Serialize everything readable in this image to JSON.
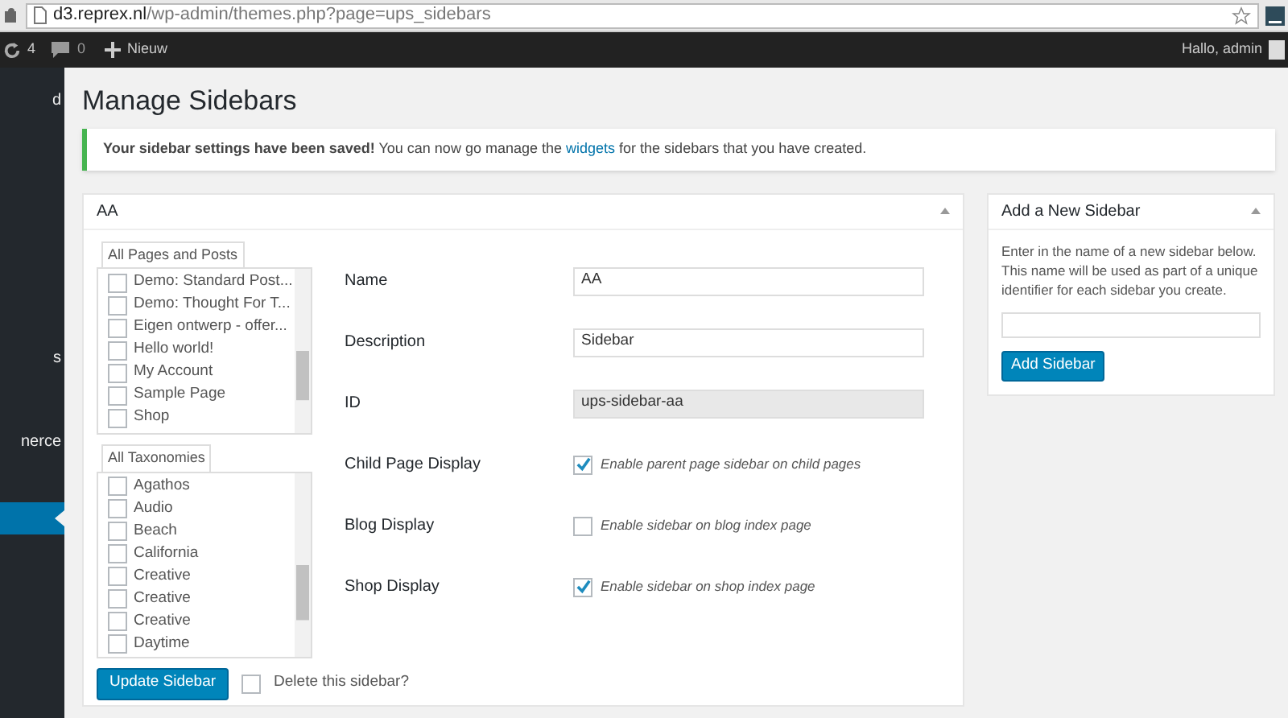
{
  "browser": {
    "url_host": "d3.reprex.nl",
    "url_path": "/wp-admin/themes.php?page=ups_sidebars"
  },
  "admin_bar": {
    "updates": "4",
    "comments": "0",
    "new_label": "Nieuw",
    "greeting": "Hallo, admin"
  },
  "admin_menu": [
    {
      "label": "d",
      "selected": false
    },
    {
      "label": "s",
      "selected": false
    },
    {
      "label": "nerce",
      "selected": false
    },
    {
      "selected": true
    }
  ],
  "page_title": "Manage Sidebars",
  "notice": {
    "text": "**Your sidebar settings have been saved!** You can now go manage the",
    "link": "widgets",
    "text_after": "for the sidebars that you have created."
  },
  "sidebar_box": {
    "title": "AA",
    "pages_list": {
      "tab": "All Pages and Posts",
      "items": [
        {
          "label": "Demo: Standard Post...",
          "checked": false
        },
        {
          "label": "Demo: Thought For T...",
          "checked": false
        },
        {
          "label": "Eigen ontwerp - offer...",
          "checked": false
        },
        {
          "label": "Hello world!",
          "checked": false
        },
        {
          "label": "My Account",
          "checked": false
        },
        {
          "label": "Sample Page",
          "checked": false
        },
        {
          "label": "Shop",
          "checked": false
        }
      ]
    },
    "taxonomies_list": {
      "tab": "All Taxonomies",
      "items": [
        {
          "label": "Agathos",
          "checked": false
        },
        {
          "label": "Audio",
          "checked": false
        },
        {
          "label": "Beach",
          "checked": false
        },
        {
          "label": "California",
          "checked": false
        },
        {
          "label": "Creative",
          "checked": false
        },
        {
          "label": "Creative",
          "checked": false
        },
        {
          "label": "Creative",
          "checked": false
        },
        {
          "label": "Daytime",
          "checked": false
        }
      ]
    },
    "fields": [
      {
        "kind": "text",
        "label": "Name",
        "value": "AA",
        "disabled": false
      },
      {
        "kind": "text",
        "label": "Description",
        "value": "Sidebar",
        "disabled": false
      },
      {
        "kind": "text",
        "label": "ID",
        "value": "ups-sidebar-aa",
        "disabled": true
      },
      {
        "kind": "checkbox",
        "label": "Child Page Display",
        "text": "Enable parent page sidebar on child pages",
        "checked": true
      },
      {
        "kind": "checkbox",
        "label": "Blog Display",
        "text": "Enable sidebar on blog index page",
        "checked": false
      },
      {
        "kind": "checkbox",
        "label": "Shop Display",
        "text": "Enable sidebar on shop index page",
        "checked": true
      }
    ],
    "update_button": "Update Sidebar",
    "delete_option": {
      "label": "Delete this sidebar?",
      "checked": false
    }
  },
  "new_sidebar_box": {
    "title": "Add a New Sidebar",
    "description": "Enter in the name of a new sidebar below. This name will be used as part of a unique identifier for each sidebar you create.",
    "button": "Add Sidebar"
  }
}
